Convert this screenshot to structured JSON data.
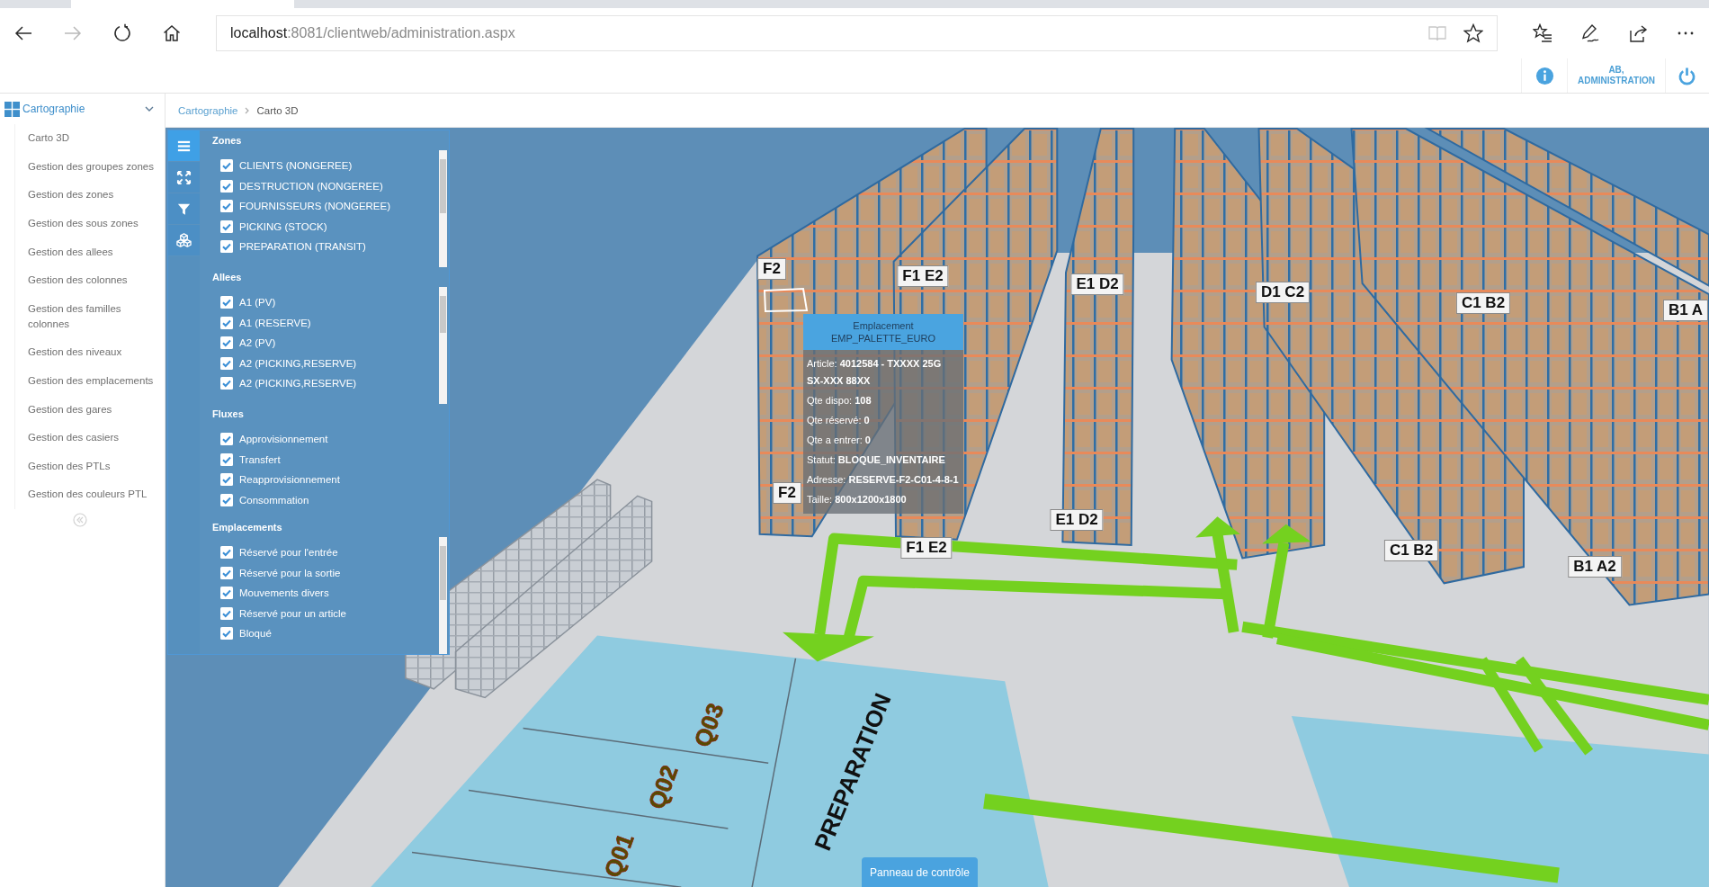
{
  "browser": {
    "nav": [
      {
        "disabled": false
      },
      {
        "disabled": true
      },
      {
        "disabled": false
      },
      {
        "disabled": false
      }
    ],
    "address": {
      "host": "localhost",
      "path": ":8081/clientweb/administration.aspx"
    },
    "reading_view": {
      "disabled": true
    }
  },
  "header": {
    "user": [
      "AB,",
      "ADMINISTRATION"
    ]
  },
  "sidebar": {
    "section": {
      "label": "Cartographie",
      "expanded": true
    },
    "items": [
      "Carto 3D",
      "Gestion des groupes zones",
      "Gestion des zones",
      "Gestion des sous zones",
      "Gestion des allees",
      "Gestion des colonnes",
      "Gestion des familles colonnes",
      "Gestion des niveaux",
      "Gestion des emplacements",
      "Gestion des gares",
      "Gestion des casiers",
      "Gestion des PTLs",
      "Gestion des couleurs PTL"
    ]
  },
  "breadcrumb": [
    "Cartographie",
    "Carto 3D"
  ],
  "scene": {
    "toolbar": [
      {
        "selected": true
      },
      {
        "selected": false
      },
      {
        "selected": false
      },
      {
        "selected": false
      }
    ],
    "filters": [
      {
        "title": "Zones",
        "kind": "scroll",
        "items": [
          {
            "label": "CLIENTS (NONGEREE)",
            "checked": true
          },
          {
            "label": "DESTRUCTION (NONGEREE)",
            "checked": true
          },
          {
            "label": "FOURNISSEURS (NONGEREE)",
            "checked": true
          },
          {
            "label": "PICKING (STOCK)",
            "checked": true
          },
          {
            "label": "PREPARATION (TRANSIT)",
            "checked": true
          }
        ]
      },
      {
        "title": "Allees",
        "kind": "scroll",
        "items": [
          {
            "label": "A1 (PV)",
            "checked": true
          },
          {
            "label": "A1 (RESERVE)",
            "checked": true
          },
          {
            "label": "A2 (PV)",
            "checked": true
          },
          {
            "label": "A2 (PICKING,RESERVE)",
            "checked": true
          },
          {
            "label": "A2 (PICKING,RESERVE)",
            "checked": true
          }
        ]
      },
      {
        "title": "Fluxes",
        "kind": "plain",
        "items": [
          {
            "label": "Approvisionnement",
            "checked": true
          },
          {
            "label": "Transfert",
            "checked": true
          },
          {
            "label": "Reapprovisionnement",
            "checked": true
          },
          {
            "label": "Consommation",
            "checked": true
          }
        ]
      },
      {
        "title": "Emplacements",
        "kind": "scroll",
        "items": [
          {
            "label": "Réservé pour l'entrée",
            "checked": true
          },
          {
            "label": "Réservé pour la sortie",
            "checked": true
          },
          {
            "label": "Mouvements divers",
            "checked": true
          },
          {
            "label": "Réservé pour un article",
            "checked": true
          },
          {
            "label": "Bloqué",
            "checked": true
          }
        ]
      }
    ],
    "rack_labels": [
      "F2",
      "F1 E2",
      "E1 D2",
      "D1 C2",
      "C1 B2",
      "B1 A",
      "F2",
      "F1 E2",
      "E1 D2",
      "C1 B2",
      "B1 A2"
    ],
    "zone_label": "PREPARATION",
    "dock_labels": [
      "Q03",
      "Q02",
      "Q01"
    ],
    "tooltip": {
      "title": "Emplacement",
      "subtitle": "EMP_PALETTE_EURO",
      "fields": [
        "Article: **4012584 - TXXXX 25G SX-XXX 88XX**",
        "Qte dispo: **108**",
        "Qte réservé: **0**",
        "Qte a entrer: **0**",
        "Statut: **BLOQUE_INVENTAIRE**",
        "Adresse: **RESERVE-F2-C01-4-8-1**",
        "Taille: **800x1200x1800**"
      ]
    },
    "control_panel_button": "Panneau de contrôle"
  }
}
